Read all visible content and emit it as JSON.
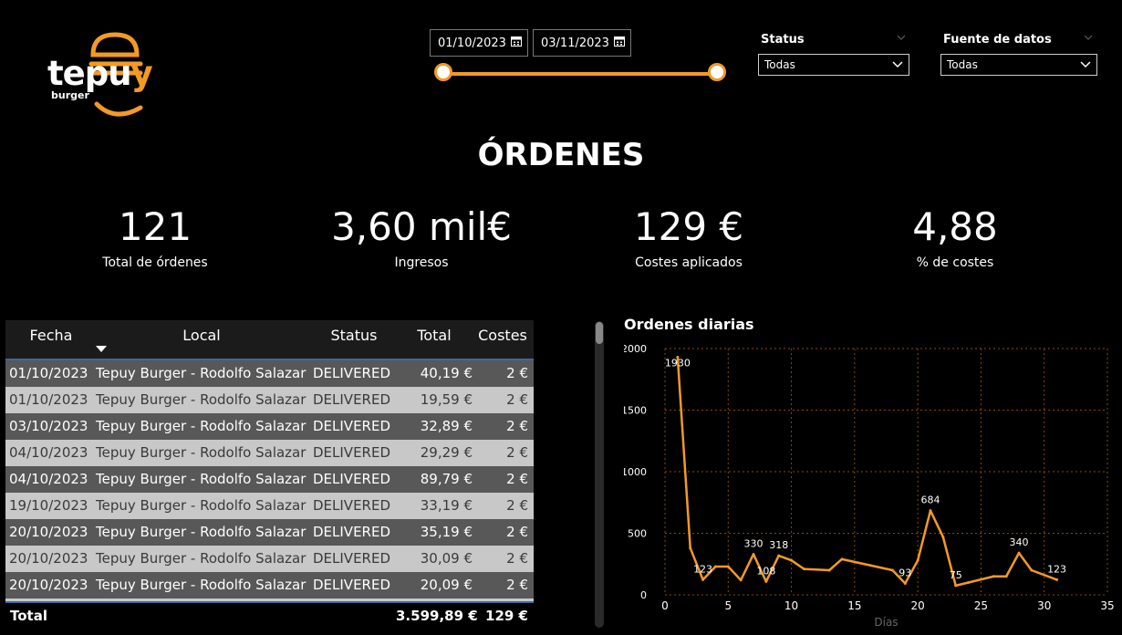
{
  "brand": {
    "logo_text_a": "tepu",
    "logo_text_b": "y",
    "logo_sub": "burger",
    "accent": "#f39a25"
  },
  "date_filter": {
    "start": "01/10/2023",
    "end": "03/11/2023",
    "range_fraction": [
      0.0,
      1.0
    ]
  },
  "filters": {
    "status": {
      "title": "Status",
      "value": "Todas"
    },
    "source": {
      "title": "Fuente de datos",
      "value": "Todas"
    }
  },
  "page_title": "ÓRDENES",
  "kpis": [
    {
      "value": "121",
      "label": "Total de órdenes"
    },
    {
      "value": "3,60 mil€",
      "label": "Ingresos"
    },
    {
      "value": "129 €",
      "label": "Costes aplicados"
    },
    {
      "value": "4,88",
      "label": "% de costes"
    }
  ],
  "table": {
    "headers": [
      "Fecha",
      "Local",
      "Status",
      "Total",
      "Costes"
    ],
    "rows": [
      [
        "01/10/2023",
        "Tepuy Burger - Rodolfo Salazar",
        "DELIVERED",
        "40,19 €",
        "2 €"
      ],
      [
        "01/10/2023",
        "Tepuy Burger - Rodolfo Salazar",
        "DELIVERED",
        "19,59 €",
        "2 €"
      ],
      [
        "03/10/2023",
        "Tepuy Burger - Rodolfo Salazar",
        "DELIVERED",
        "32,89 €",
        "2 €"
      ],
      [
        "04/10/2023",
        "Tepuy Burger - Rodolfo Salazar",
        "DELIVERED",
        "29,29 €",
        "2 €"
      ],
      [
        "04/10/2023",
        "Tepuy Burger - Rodolfo Salazar",
        "DELIVERED",
        "89,79 €",
        "2 €"
      ],
      [
        "19/10/2023",
        "Tepuy Burger - Rodolfo Salazar",
        "DELIVERED",
        "33,19 €",
        "2 €"
      ],
      [
        "20/10/2023",
        "Tepuy Burger - Rodolfo Salazar",
        "DELIVERED",
        "35,19 €",
        "2 €"
      ],
      [
        "20/10/2023",
        "Tepuy Burger - Rodolfo Salazar",
        "DELIVERED",
        "30,09 €",
        "2 €"
      ],
      [
        "20/10/2023",
        "Tepuy Burger - Rodolfo Salazar",
        "DELIVERED",
        "20,09 €",
        "2 €"
      ]
    ],
    "total": {
      "label": "Total",
      "total": "3.599,89 €",
      "costes": "129 €"
    }
  },
  "chart_data": {
    "type": "line",
    "title": "Ordenes diarias",
    "xlabel": "Días",
    "ylabel": "",
    "xlim": [
      0,
      35
    ],
    "ylim": [
      0,
      2000
    ],
    "xticks": [
      0,
      5,
      10,
      15,
      20,
      25,
      30,
      35
    ],
    "yticks": [
      0,
      500,
      1000,
      1500,
      2000
    ],
    "grid": true,
    "color": "#f39a25",
    "x": [
      1,
      2,
      3,
      4,
      5,
      6,
      7,
      8,
      9,
      10,
      11,
      13,
      14,
      18,
      19,
      20,
      21,
      22,
      23,
      24,
      26,
      27,
      28,
      29,
      31
    ],
    "y": [
      1930,
      380,
      123,
      230,
      230,
      120,
      330,
      108,
      318,
      280,
      210,
      200,
      290,
      200,
      93,
      280,
      684,
      470,
      75,
      100,
      150,
      150,
      340,
      200,
      123
    ],
    "data_labels": [
      {
        "x": 1,
        "y": 1930,
        "text": "1930"
      },
      {
        "x": 3,
        "y": 123,
        "text": "123"
      },
      {
        "x": 7,
        "y": 330,
        "text": "330"
      },
      {
        "x": 8,
        "y": 108,
        "text": "108"
      },
      {
        "x": 9,
        "y": 318,
        "text": "318"
      },
      {
        "x": 19,
        "y": 93,
        "text": "93"
      },
      {
        "x": 21,
        "y": 684,
        "text": "684"
      },
      {
        "x": 23,
        "y": 75,
        "text": "75"
      },
      {
        "x": 28,
        "y": 340,
        "text": "340"
      },
      {
        "x": 31,
        "y": 123,
        "text": "123"
      }
    ]
  }
}
